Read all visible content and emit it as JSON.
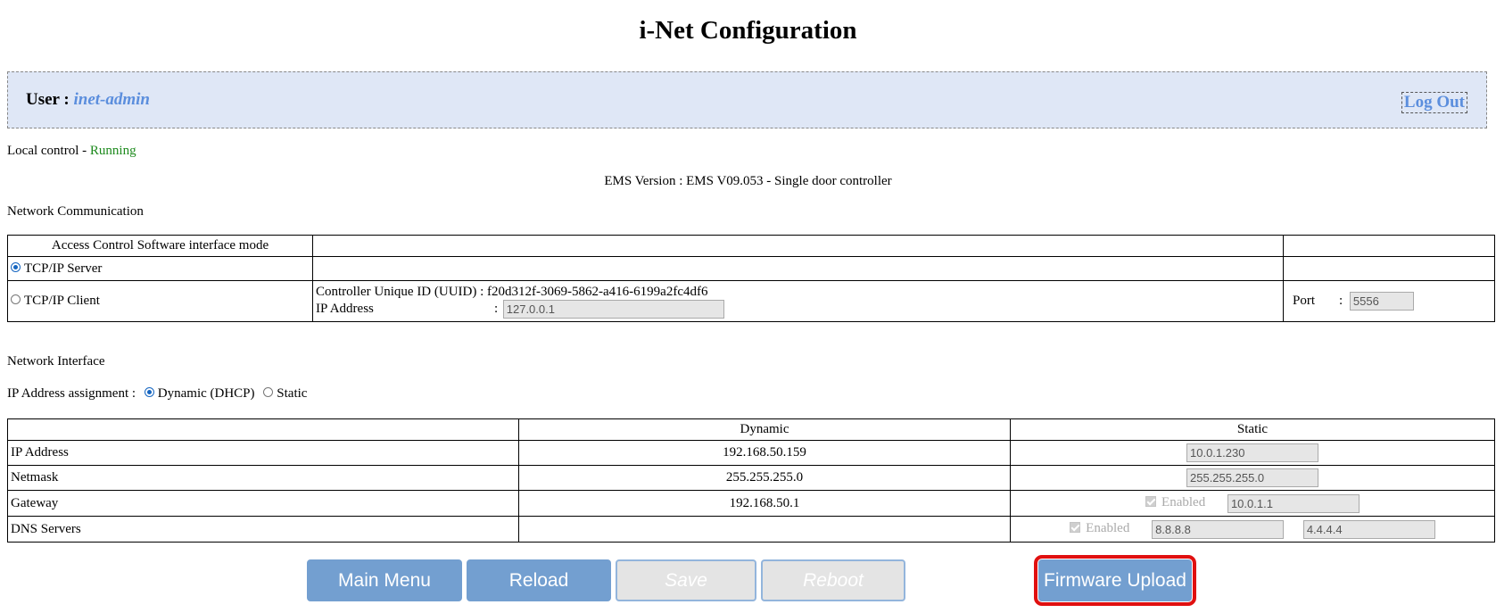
{
  "page": {
    "title": "i-Net Configuration"
  },
  "user": {
    "label": "User :",
    "name": "inet-admin",
    "logout": "Log Out"
  },
  "status": {
    "label": "Local control -",
    "value": "Running"
  },
  "ems_version": "EMS Version : EMS V09.053 - Single door controller",
  "network_communication": {
    "heading": "Network Communication",
    "mode_header": "Access Control Software interface mode",
    "server_label": "TCP/IP Server",
    "client_label": "TCP/IP Client",
    "selected": "TCP/IP Server",
    "uuid_label": "Controller Unique ID (UUID) :",
    "uuid_value": "f20d312f-3069-5862-a416-6199a2fc4df6",
    "ip_label": "IP Address",
    "ip_colon": ":",
    "ip_value": "127.0.0.1",
    "port_label": "Port",
    "port_colon": ":",
    "port_value": "5556"
  },
  "network_interface": {
    "heading": "Network Interface",
    "assign_label": "IP Address assignment :",
    "dhcp_label": "Dynamic (DHCP)",
    "static_label": "Static",
    "selected": "Dynamic (DHCP)",
    "col_dynamic": "Dynamic",
    "col_static": "Static",
    "rows": {
      "ip": {
        "label": "IP Address",
        "dynamic": "192.168.50.159",
        "static": "10.0.1.230"
      },
      "netmask": {
        "label": "Netmask",
        "dynamic": "255.255.255.0",
        "static": "255.255.255.0"
      },
      "gateway": {
        "label": "Gateway",
        "dynamic": "192.168.50.1",
        "enabled_label": "Enabled",
        "static": "10.0.1.1"
      },
      "dns": {
        "label": "DNS Servers",
        "dynamic": "",
        "enabled_label": "Enabled",
        "static1": "8.8.8.8",
        "static2": "4.4.4.4"
      }
    }
  },
  "buttons": {
    "main_menu": "Main Menu",
    "reload": "Reload",
    "save": "Save",
    "reboot": "Reboot",
    "firmware_upload": "Firmware Upload"
  },
  "colors": {
    "accent": "#5b8edd",
    "button": "#739fd0",
    "running": "#1d8a1d",
    "highlight": "#e01010",
    "userbar_bg": "#dfe7f6"
  }
}
